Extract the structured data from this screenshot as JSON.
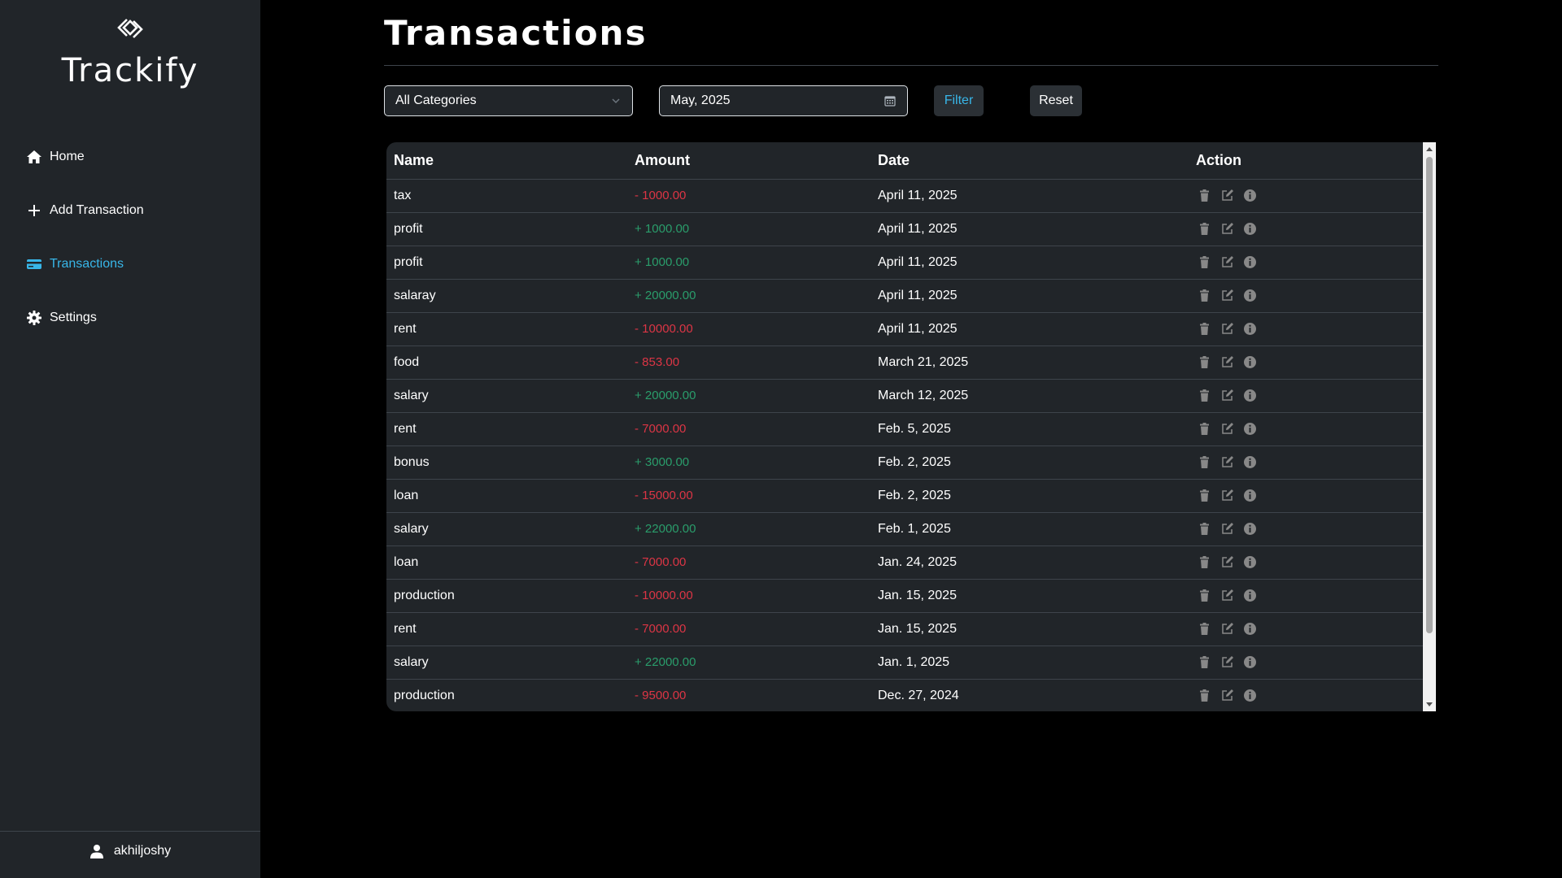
{
  "app": {
    "brand_name": "Trackify"
  },
  "sidebar": {
    "items": [
      {
        "label": "Home",
        "icon": "home-icon"
      },
      {
        "label": "Add Transaction",
        "icon": "plus-icon"
      },
      {
        "label": "Transactions",
        "icon": "credit-card-icon"
      },
      {
        "label": "Settings",
        "icon": "gear-icon"
      }
    ],
    "active_item": "Transactions",
    "user": "akhiljoshy"
  },
  "page": {
    "title": "Transactions"
  },
  "filters": {
    "category_selected": "All Categories",
    "month_value": "May, 2025",
    "filter_label": "Filter",
    "reset_label": "Reset"
  },
  "table": {
    "headers": [
      "Name",
      "Amount",
      "Date",
      "Action"
    ],
    "rows": [
      {
        "name": "tax",
        "amount": "- 1000.00",
        "type": "neg",
        "date": "April 11, 2025"
      },
      {
        "name": "profit",
        "amount": "+ 1000.00",
        "type": "pos",
        "date": "April 11, 2025"
      },
      {
        "name": "profit",
        "amount": "+ 1000.00",
        "type": "pos",
        "date": "April 11, 2025"
      },
      {
        "name": "salaray",
        "amount": "+ 20000.00",
        "type": "pos",
        "date": "April 11, 2025"
      },
      {
        "name": "rent",
        "amount": "- 10000.00",
        "type": "neg",
        "date": "April 11, 2025"
      },
      {
        "name": "food",
        "amount": "- 853.00",
        "type": "neg",
        "date": "March 21, 2025"
      },
      {
        "name": "salary",
        "amount": "+ 20000.00",
        "type": "pos",
        "date": "March 12, 2025"
      },
      {
        "name": "rent",
        "amount": "- 7000.00",
        "type": "neg",
        "date": "Feb. 5, 2025"
      },
      {
        "name": "bonus",
        "amount": "+ 3000.00",
        "type": "pos",
        "date": "Feb. 2, 2025"
      },
      {
        "name": "loan",
        "amount": "- 15000.00",
        "type": "neg",
        "date": "Feb. 2, 2025"
      },
      {
        "name": "salary",
        "amount": "+ 22000.00",
        "type": "pos",
        "date": "Feb. 1, 2025"
      },
      {
        "name": "loan",
        "amount": "- 7000.00",
        "type": "neg",
        "date": "Jan. 24, 2025"
      },
      {
        "name": "production",
        "amount": "- 10000.00",
        "type": "neg",
        "date": "Jan. 15, 2025"
      },
      {
        "name": "rent",
        "amount": "- 7000.00",
        "type": "neg",
        "date": "Jan. 15, 2025"
      },
      {
        "name": "salary",
        "amount": "+ 22000.00",
        "type": "pos",
        "date": "Jan. 1, 2025"
      },
      {
        "name": "production",
        "amount": "- 9500.00",
        "type": "neg",
        "date": "Dec. 27, 2024"
      }
    ],
    "row_action_icons": [
      "trash-icon",
      "edit-icon",
      "info-icon"
    ]
  },
  "colors": {
    "sidebar_bg": "#212529",
    "page_bg": "#000000",
    "accent": "#38b6e8",
    "negative": "#dc3545",
    "positive": "#2a9d6b"
  }
}
